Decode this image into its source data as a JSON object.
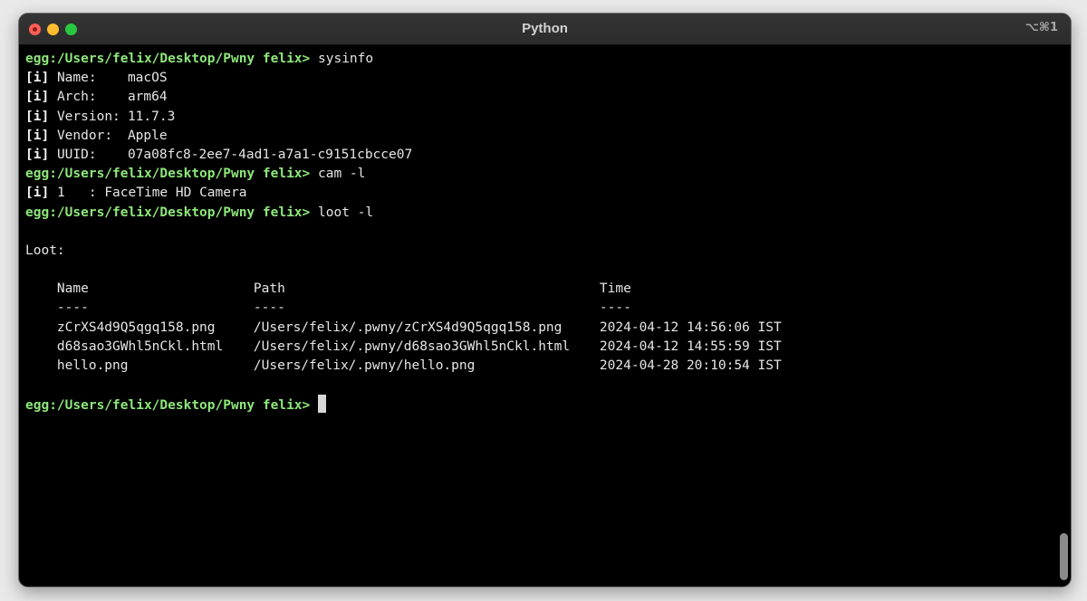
{
  "window": {
    "title": "Python",
    "shortcut": "⌥⌘1"
  },
  "prompt": "egg:/Users/felix/Desktop/Pwny felix>",
  "commands": {
    "sysinfo": "sysinfo",
    "cam": "cam -l",
    "loot": "loot -l"
  },
  "info_tag": "[i]",
  "sysinfo": [
    {
      "key": "Name:",
      "value": "macOS"
    },
    {
      "key": "Arch:",
      "value": "arm64"
    },
    {
      "key": "Version:",
      "value": "11.7.3"
    },
    {
      "key": "Vendor:",
      "value": "Apple"
    },
    {
      "key": "UUID:",
      "value": "07a08fc8-2ee7-4ad1-a7a1-c9151cbcce07"
    }
  ],
  "cam": {
    "line": "1   : FaceTime HD Camera"
  },
  "loot": {
    "heading": "Loot:",
    "headers": {
      "name": "Name",
      "path": "Path",
      "time": "Time"
    },
    "separator": "----",
    "rows": [
      {
        "name": "zCrXS4d9Q5qgq158.png",
        "path": "/Users/felix/.pwny/zCrXS4d9Q5qgq158.png",
        "time": "2024-04-12 14:56:06 IST"
      },
      {
        "name": "d68sao3GWhl5nCkl.html",
        "path": "/Users/felix/.pwny/d68sao3GWhl5nCkl.html",
        "time": "2024-04-12 14:55:59 IST"
      },
      {
        "name": "hello.png",
        "path": "/Users/felix/.pwny/hello.png",
        "time": "2024-04-28 20:10:54 IST"
      }
    ]
  }
}
